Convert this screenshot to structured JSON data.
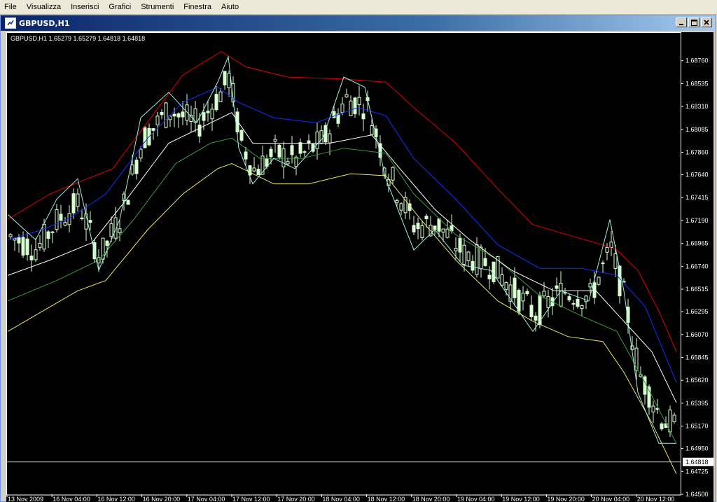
{
  "menu": [
    "File",
    "Visualizza",
    "Inserisci",
    "Grafici",
    "Strumenti",
    "Finestra",
    "Aiuto"
  ],
  "window": {
    "title": "GBPUSD,H1"
  },
  "chart_data": {
    "type": "candlestick",
    "symbol_info": "GBPUSD,H1  1.65279 1.65279 1.64818 1.64818",
    "current_price": "1.64818",
    "ylim": [
      1.645,
      1.68985
    ],
    "yticks": [
      "1.68760",
      "1.68535",
      "1.68310",
      "1.68085",
      "1.67860",
      "1.67640",
      "1.67415",
      "1.67190",
      "1.66965",
      "1.66740",
      "1.66515",
      "1.66295",
      "1.66070",
      "1.65845",
      "1.65620",
      "1.65395",
      "1.65170",
      "1.64950",
      "1.64725",
      "1.64500"
    ],
    "xticks": [
      "13 Nov 2009",
      "16 Nov 04:00",
      "16 Nov 12:00",
      "16 Nov 20:00",
      "17 Nov 04:00",
      "17 Nov 12:00",
      "17 Nov 20:00",
      "18 Nov 04:00",
      "18 Nov 12:00",
      "18 Nov 20:00",
      "19 Nov 04:00",
      "19 Nov 12:00",
      "19 Nov 20:00",
      "20 Nov 04:00",
      "20 Nov 12:00"
    ],
    "colors": {
      "red": "#e00000",
      "blue": "#1030ff",
      "white": "#ffffff",
      "green": "#3a9a3a",
      "yellow": "#e8e860",
      "cyan": "#a0f0e0",
      "candle": "#d8ffd0",
      "bull": "#000000"
    },
    "series": {
      "red": [
        [
          0,
          1.672
        ],
        [
          60,
          1.6745
        ],
        [
          150,
          1.677
        ],
        [
          250,
          1.6862
        ],
        [
          305,
          1.6885
        ],
        [
          340,
          1.687
        ],
        [
          400,
          1.686
        ],
        [
          480,
          1.6858
        ],
        [
          540,
          1.6855
        ],
        [
          580,
          1.683
        ],
        [
          640,
          1.6795
        ],
        [
          700,
          1.675
        ],
        [
          750,
          1.6715
        ],
        [
          800,
          1.6705
        ],
        [
          850,
          1.6695
        ],
        [
          870,
          1.669
        ],
        [
          900,
          1.667
        ],
        [
          930,
          1.663
        ],
        [
          955,
          1.659
        ]
      ],
      "blue": [
        [
          0,
          1.67
        ],
        [
          50,
          1.671
        ],
        [
          90,
          1.6722
        ],
        [
          140,
          1.6745
        ],
        [
          200,
          1.68
        ],
        [
          250,
          1.6835
        ],
        [
          300,
          1.685
        ],
        [
          330,
          1.6835
        ],
        [
          380,
          1.682
        ],
        [
          440,
          1.6815
        ],
        [
          500,
          1.683
        ],
        [
          540,
          1.6822
        ],
        [
          580,
          1.678
        ],
        [
          640,
          1.674
        ],
        [
          700,
          1.6695
        ],
        [
          760,
          1.6672
        ],
        [
          820,
          1.6672
        ],
        [
          870,
          1.6665
        ],
        [
          910,
          1.6635
        ],
        [
          955,
          1.656
        ]
      ],
      "white": [
        [
          0,
          1.6665
        ],
        [
          60,
          1.668
        ],
        [
          120,
          1.6697
        ],
        [
          170,
          1.674
        ],
        [
          230,
          1.6795
        ],
        [
          290,
          1.6815
        ],
        [
          320,
          1.6825
        ],
        [
          350,
          1.6795
        ],
        [
          400,
          1.6795
        ],
        [
          460,
          1.6795
        ],
        [
          520,
          1.6803
        ],
        [
          560,
          1.677
        ],
        [
          610,
          1.673
        ],
        [
          660,
          1.67
        ],
        [
          720,
          1.667
        ],
        [
          780,
          1.665
        ],
        [
          840,
          1.665
        ],
        [
          880,
          1.662
        ],
        [
          920,
          1.659
        ],
        [
          955,
          1.654
        ]
      ],
      "green": [
        [
          0,
          1.664
        ],
        [
          70,
          1.666
        ],
        [
          130,
          1.668
        ],
        [
          180,
          1.672
        ],
        [
          240,
          1.6775
        ],
        [
          290,
          1.6795
        ],
        [
          320,
          1.68
        ],
        [
          360,
          1.678
        ],
        [
          420,
          1.678
        ],
        [
          480,
          1.679
        ],
        [
          540,
          1.6785
        ],
        [
          580,
          1.6745
        ],
        [
          640,
          1.6705
        ],
        [
          700,
          1.668
        ],
        [
          760,
          1.6645
        ],
        [
          820,
          1.6625
        ],
        [
          870,
          1.661
        ],
        [
          910,
          1.656
        ],
        [
          955,
          1.65
        ]
      ],
      "yellow": [
        [
          0,
          1.661
        ],
        [
          50,
          1.663
        ],
        [
          100,
          1.665
        ],
        [
          140,
          1.666
        ],
        [
          200,
          1.671
        ],
        [
          250,
          1.6745
        ],
        [
          300,
          1.677
        ],
        [
          320,
          1.6775
        ],
        [
          380,
          1.6755
        ],
        [
          430,
          1.6755
        ],
        [
          490,
          1.6765
        ],
        [
          540,
          1.6763
        ],
        [
          590,
          1.672
        ],
        [
          640,
          1.668
        ],
        [
          700,
          1.664
        ],
        [
          750,
          1.662
        ],
        [
          800,
          1.6605
        ],
        [
          850,
          1.66
        ],
        [
          880,
          1.657
        ],
        [
          920,
          1.652
        ],
        [
          955,
          1.647
        ]
      ],
      "cyan": [
        [
          0,
          1.6725
        ],
        [
          40,
          1.67
        ],
        [
          70,
          1.674
        ],
        [
          100,
          1.676
        ],
        [
          130,
          1.667
        ],
        [
          160,
          1.672
        ],
        [
          190,
          1.682
        ],
        [
          230,
          1.6845
        ],
        [
          270,
          1.6815
        ],
        [
          300,
          1.6855
        ],
        [
          315,
          1.688
        ],
        [
          330,
          1.679
        ],
        [
          350,
          1.6755
        ],
        [
          380,
          1.678
        ],
        [
          410,
          1.677
        ],
        [
          450,
          1.68
        ],
        [
          480,
          1.686
        ],
        [
          510,
          1.685
        ],
        [
          540,
          1.676
        ],
        [
          580,
          1.669
        ],
        [
          610,
          1.671
        ],
        [
          650,
          1.6675
        ],
        [
          690,
          1.667
        ],
        [
          720,
          1.664
        ],
        [
          750,
          1.661
        ],
        [
          790,
          1.665
        ],
        [
          830,
          1.664
        ],
        [
          860,
          1.672
        ],
        [
          880,
          1.665
        ],
        [
          900,
          1.655
        ],
        [
          930,
          1.65
        ],
        [
          955,
          1.65
        ]
      ]
    },
    "candles_seed": 7
  }
}
